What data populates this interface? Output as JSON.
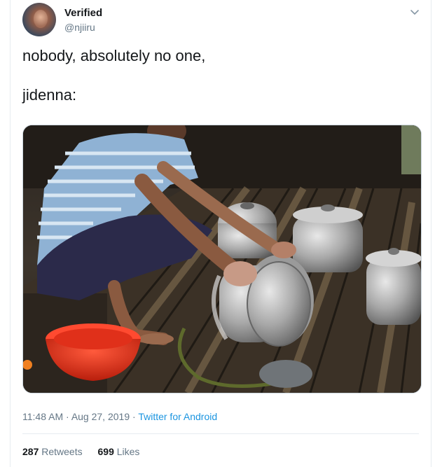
{
  "author": {
    "display_name": "Verified",
    "handle": "@njiiru"
  },
  "icons": {
    "menu": "chevron-down-icon"
  },
  "tweet": {
    "line1": "nobody, absolutely no one,",
    "line2": "jidenna:"
  },
  "media": {
    "alt_icon": "photo"
  },
  "meta": {
    "time": "11:48 AM",
    "separator1": "·",
    "date": "Aug 27, 2019",
    "separator2": "·",
    "source": "Twitter for Android"
  },
  "stats": {
    "retweets_count": "287",
    "retweets_label": "Retweets",
    "likes_count": "699",
    "likes_label": "Likes"
  },
  "colors": {
    "link": "#1b95e0",
    "muted": "#657786",
    "text": "#14171a",
    "border": "#e6ecf0"
  }
}
